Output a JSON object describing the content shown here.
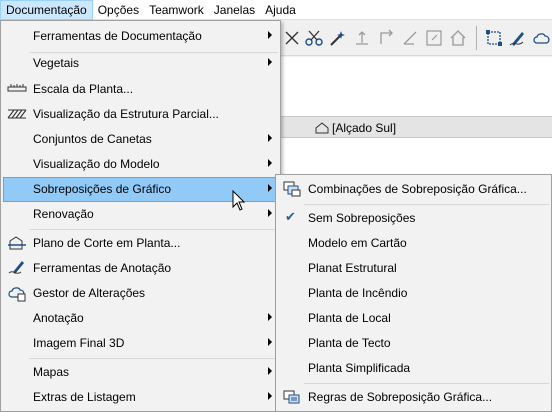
{
  "menubar": {
    "items": [
      {
        "label": "Documentação",
        "active": true
      },
      {
        "label": "Opções"
      },
      {
        "label": "Teamwork"
      },
      {
        "label": "Janelas"
      },
      {
        "label": "Ajuda"
      }
    ]
  },
  "view_tab": {
    "label": "[Alçado Sul]",
    "icon": "house-outline-icon"
  },
  "main_menu": {
    "items": [
      {
        "label": "Ferramentas de Documentação",
        "submenu": true
      },
      {
        "label": "Vegetais",
        "submenu": true
      },
      {
        "label": "Escala da Planta...",
        "icon": "ruler-scale-icon"
      },
      {
        "label": "Visualização da Estrutura Parcial...",
        "icon": "hatch-structure-icon"
      },
      {
        "label": "Conjuntos de Canetas",
        "submenu": true
      },
      {
        "label": "Visualização do Modelo",
        "submenu": true
      },
      {
        "label": "Sobreposições de Gráfico",
        "submenu": true,
        "highlighted": true
      },
      {
        "label": "Renovação",
        "submenu": true
      },
      {
        "label": "Plano de Corte em Planta...",
        "icon": "cut-plane-icon"
      },
      {
        "label": "Ferramentas de Anotação",
        "icon": "annotation-pen-icon"
      },
      {
        "label": "Gestor de Alterações",
        "icon": "change-manager-icon"
      },
      {
        "label": "Anotação",
        "submenu": true
      },
      {
        "label": "Imagem Final 3D",
        "submenu": true
      },
      {
        "label": "Mapas",
        "submenu": true
      },
      {
        "label": "Extras de Listagem",
        "submenu": true
      }
    ]
  },
  "sub_menu": {
    "items": [
      {
        "label": "Combinações de Sobreposição Gráfica...",
        "icon": "overlay-combinations-icon"
      },
      {
        "label": "Sem Sobreposições",
        "checked": true
      },
      {
        "label": "Modelo em Cartão"
      },
      {
        "label": "Planat Estrutural"
      },
      {
        "label": "Planta de Incêndio"
      },
      {
        "label": "Planta de Local"
      },
      {
        "label": "Planta de Tecto"
      },
      {
        "label": "Planta Simplificada"
      },
      {
        "label": "Regras de Sobreposição Gráfica...",
        "icon": "overlay-rules-icon"
      }
    ]
  },
  "colors": {
    "menu_bg": "#f2f2f2",
    "highlight": "#91c9f7",
    "menubar_active": "#cce8ff",
    "check": "#1f5fa8"
  }
}
